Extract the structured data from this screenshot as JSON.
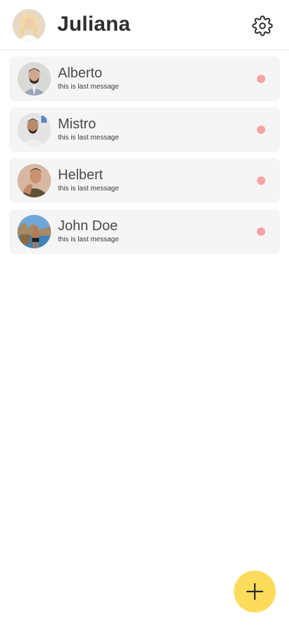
{
  "header": {
    "title": "Juliana",
    "avatar_icon": "user-avatar",
    "settings_icon": "gear-icon"
  },
  "chats": [
    {
      "name": "Alberto",
      "last_message": "this is last message",
      "avatar_icon": "contact-photo",
      "unread": true
    },
    {
      "name": "Mistro",
      "last_message": "this is last message",
      "avatar_icon": "contact-photo",
      "unread": true
    },
    {
      "name": "Helbert",
      "last_message": "this is last message",
      "avatar_icon": "contact-photo",
      "unread": true
    },
    {
      "name": "John Doe",
      "last_message": "this is last message",
      "avatar_icon": "contact-photo",
      "unread": true
    }
  ],
  "fab": {
    "icon": "plus-icon"
  },
  "colors": {
    "unread_dot": "#f7a3a3",
    "fab_background": "#fddc5c",
    "row_background": "#f5f5f5"
  }
}
